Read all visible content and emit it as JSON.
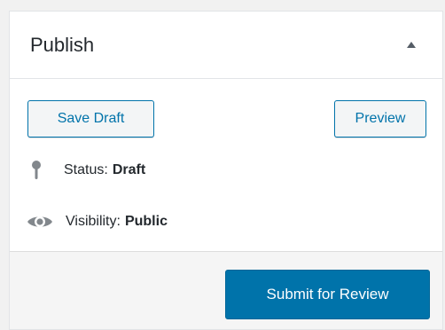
{
  "panel": {
    "title": "Publish"
  },
  "actions": {
    "save_draft_label": "Save Draft",
    "preview_label": "Preview",
    "submit_label": "Submit for Review"
  },
  "status": {
    "icon": "pin-icon",
    "label": "Status:",
    "value": "Draft"
  },
  "visibility": {
    "icon": "eye-icon",
    "label": "Visibility:",
    "value": "Public"
  },
  "colors": {
    "accent": "#0073aa",
    "text": "#23282d",
    "footer_bg": "#f5f5f5"
  }
}
